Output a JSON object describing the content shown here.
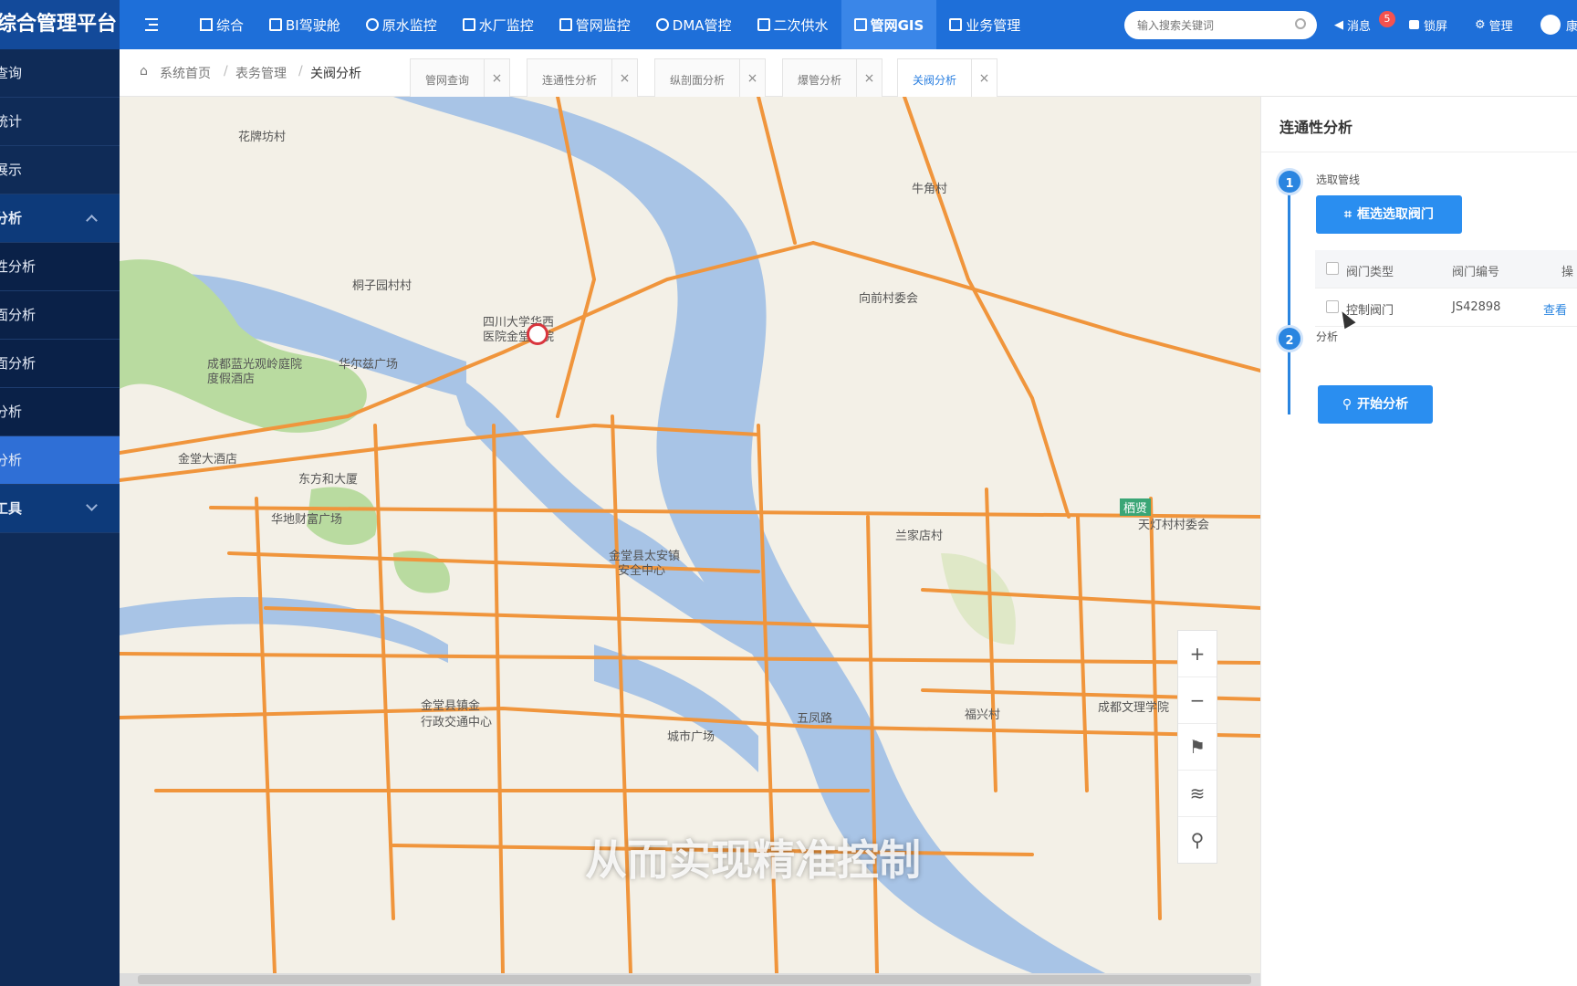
{
  "brand": "综合管理平台",
  "nav": [
    {
      "label": "综合"
    },
    {
      "label": "BI驾驶舱"
    },
    {
      "label": "原水监控"
    },
    {
      "label": "水厂监控"
    },
    {
      "label": "管网监控"
    },
    {
      "label": "DMA管控"
    },
    {
      "label": "二次供水"
    },
    {
      "label": "管网GIS",
      "active": true
    },
    {
      "label": "业务管理"
    }
  ],
  "search": {
    "placeholder": "输入搜索关键词"
  },
  "top_right": {
    "messages": "消息",
    "badge": "5",
    "lock": "锁屏",
    "manage": "管理",
    "user": "康"
  },
  "sidebar": {
    "items": [
      {
        "label": "查询"
      },
      {
        "label": "统计"
      },
      {
        "label": "展示"
      },
      {
        "label": "分析",
        "group": true,
        "expanded": true
      },
      {
        "label": "性分析",
        "sub": true
      },
      {
        "label": "面分析",
        "sub": true
      },
      {
        "label": "面分析",
        "sub": true
      },
      {
        "label": "分析",
        "sub": true
      },
      {
        "label": "分析",
        "sub": true,
        "active": true
      },
      {
        "label": "工具",
        "group": true,
        "expanded": false
      }
    ]
  },
  "breadcrumb": {
    "home": "系统首页",
    "sep": "/",
    "level2": "表务管理",
    "current": "关阀分析"
  },
  "tabs": [
    {
      "label": "管网查询"
    },
    {
      "label": "连通性分析"
    },
    {
      "label": "纵剖面分析"
    },
    {
      "label": "爆管分析"
    },
    {
      "label": "关阀分析",
      "active": true
    }
  ],
  "map": {
    "labels": [
      "花牌坊村",
      "桐子园村村",
      "四川大学华西",
      "医院金堂分院",
      "成都蓝光观岭庭院",
      "度假酒店",
      "华尔兹广场",
      "牛角村",
      "向前村委会",
      "金堂大酒店",
      "东方和大厦",
      "华地财富广场",
      "金堂县太安镇",
      "安全中心",
      "兰家店村",
      "天灯村村委会",
      "成都文理学院",
      "福兴村",
      "城市广场",
      "金堂县镇金",
      "行政交通中心",
      "五凤路",
      "栖贤"
    ],
    "subtitle": "从而实现精准控制",
    "controls": [
      "zoom-in",
      "zoom-out",
      "flag",
      "layers",
      "location"
    ]
  },
  "panel": {
    "title": "连通性分析",
    "step1": {
      "num": "1",
      "label": "选取管线",
      "button": "框选选取阀门"
    },
    "table": {
      "headers": [
        "阀门类型",
        "阀门编号",
        "操"
      ],
      "rows": [
        {
          "type": "控制阀门",
          "code": "JS42898",
          "action": "查看"
        }
      ]
    },
    "step2": {
      "num": "2",
      "label": "分析",
      "button": "开始分析"
    }
  },
  "colors": {
    "topbar": "#1e6fd9",
    "sidebar": "#0f2b57",
    "accent": "#2a85e0",
    "pipe": "#f0953c",
    "river": "#a8c4e6"
  }
}
